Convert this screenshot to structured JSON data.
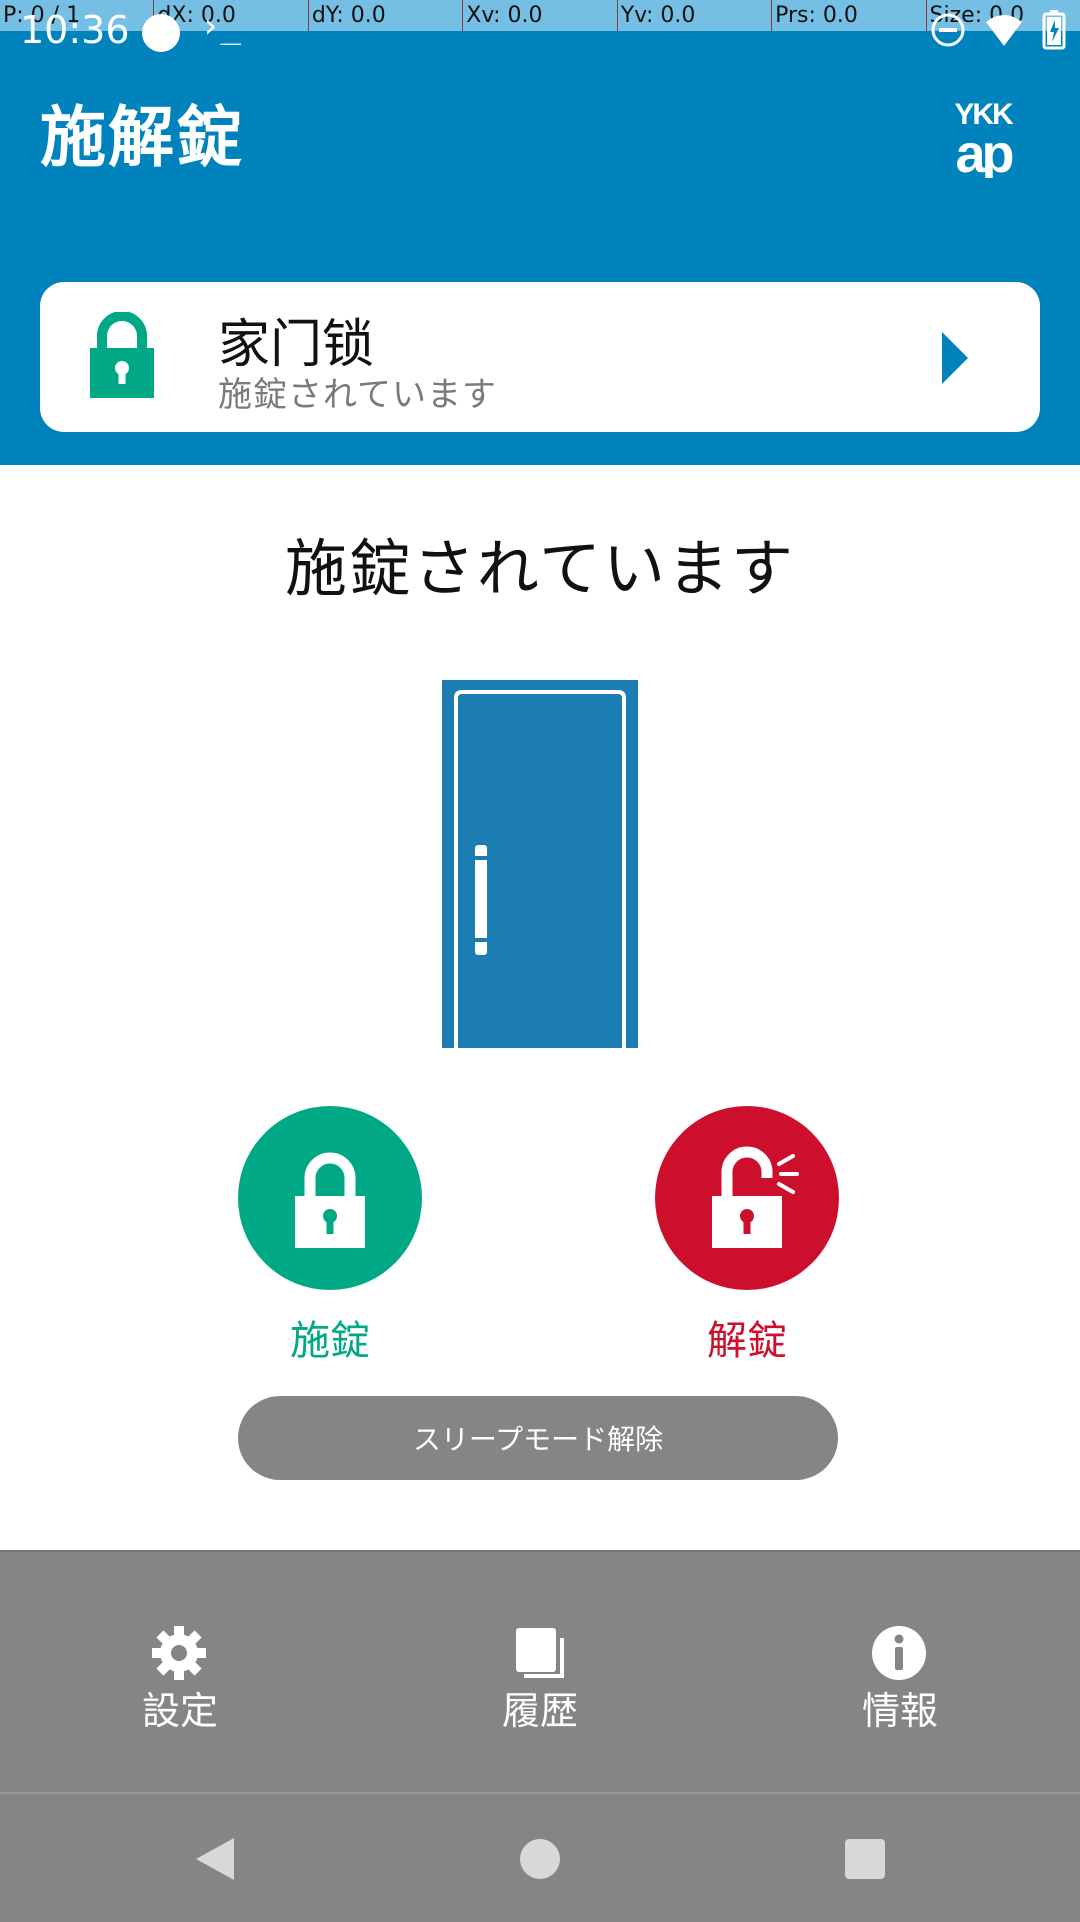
{
  "debug": {
    "pointer": "P: 0 / 1",
    "dx": "dX: 0.0",
    "dy": "dY: 0.0",
    "xv": "Xv: 0.0",
    "yv": "Yv: 0.0",
    "prs": "Prs: 0.0",
    "size": "Size: 0.0"
  },
  "status_bar": {
    "time": "10:36",
    "terminal_glyph": "›_"
  },
  "header": {
    "title": "施解錠",
    "brand_logo_name": "ykk-ap-logo"
  },
  "lock_card": {
    "name": "家门锁",
    "status": "施錠されています"
  },
  "main": {
    "status_text": "施錠されています",
    "lock_label": "施錠",
    "unlock_label": "解錠",
    "sleep_button": "スリープモード解除"
  },
  "tabs": [
    {
      "label": "設定",
      "icon": "gear-icon"
    },
    {
      "label": "履歴",
      "icon": "history-icon"
    },
    {
      "label": "情報",
      "icon": "info-icon"
    }
  ],
  "colors": {
    "header_blue": "#0083BD",
    "lock_green": "#00A886",
    "unlock_red": "#CC0F2C",
    "door_blue": "#1B7DB2",
    "bar_gray": "#858585"
  }
}
